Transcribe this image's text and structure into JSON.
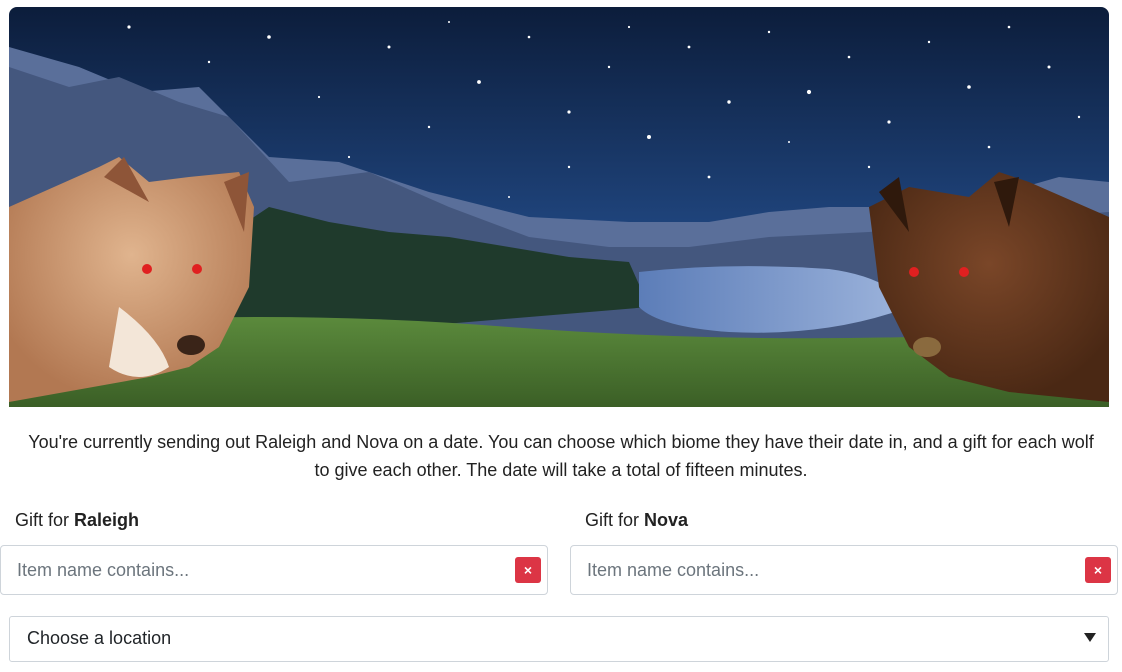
{
  "intro": {
    "line1": "You're currently sending out Raleigh and Nova on a date. You can choose which biome they have their date in, and a gift for each wolf",
    "line2": "to give each other. The date will take a total of fifteen minutes."
  },
  "gift_raleigh": {
    "prefix": "Gift for ",
    "wolf_name": "Raleigh",
    "placeholder": "Item name contains...",
    "clear_icon": "×"
  },
  "gift_nova": {
    "prefix": "Gift for ",
    "wolf_name": "Nova",
    "placeholder": "Item name contains...",
    "clear_icon": "×"
  },
  "location": {
    "selected": "Choose a location"
  },
  "colors": {
    "clear_button": "#dc3545",
    "border": "#ced4da",
    "sky_top": "#0d1f3c",
    "sky_bottom": "#2f5c9a"
  }
}
